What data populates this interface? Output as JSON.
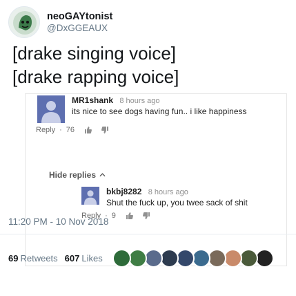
{
  "author": {
    "display_name": "neoGAYtonist",
    "handle": "@DxGGEAUX"
  },
  "tweet": {
    "text": "[drake singing voice]\n[drake rapping voice]"
  },
  "youtube": {
    "comment": {
      "author": "MR1shank",
      "time": "8 hours ago",
      "text": "its nice to see dogs having fun.. i like happiness",
      "reply_label": "Reply",
      "likes": "76"
    },
    "hide_replies_label": "Hide replies",
    "reply": {
      "author": "bkbj8282",
      "time": "8 hours ago",
      "text": "Shut the fuck up, you twee sack of shit",
      "reply_label": "Reply",
      "likes": "9"
    }
  },
  "timestamp": "11:20 PM - 10 Nov 2018",
  "stats": {
    "retweets_count": "69",
    "retweets_label": "Retweets",
    "likes_count": "607",
    "likes_label": "Likes"
  },
  "liker_colors": [
    "#2e6b3a",
    "#3f7d44",
    "#5a6b8c",
    "#2d3b4f",
    "#34486b",
    "#3b6b8f",
    "#7a6a5a",
    "#c98a6a",
    "#4a5a3a",
    "#222222"
  ]
}
